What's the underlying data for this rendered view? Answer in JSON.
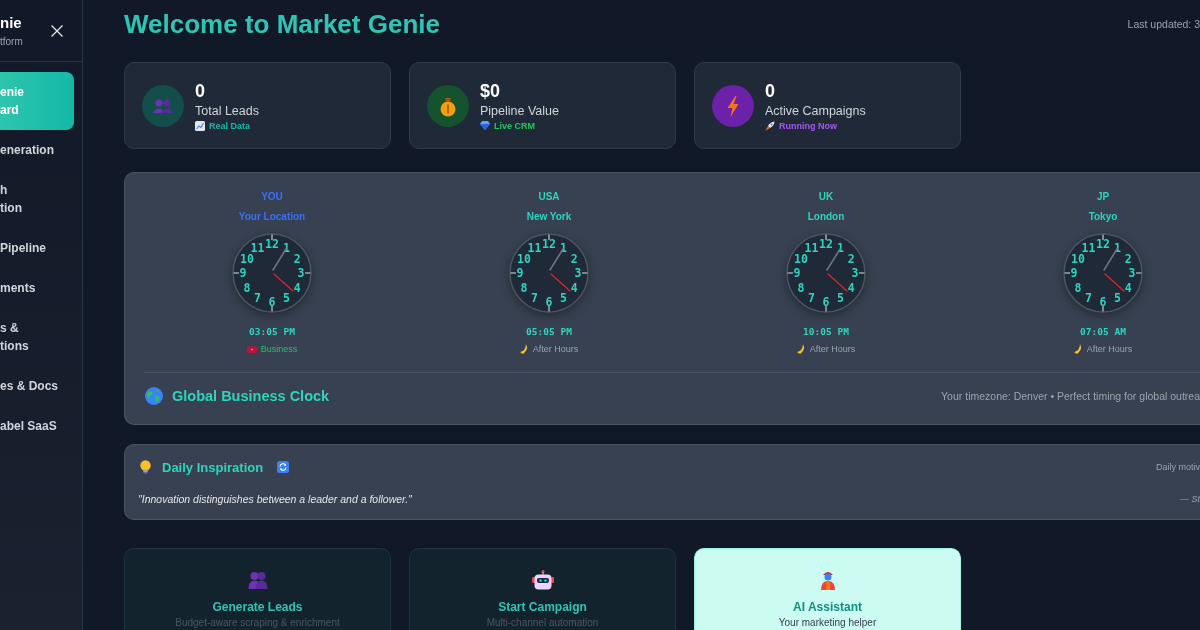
{
  "sidebar": {
    "brand": "nie",
    "tagline": "tform",
    "items": [
      {
        "lines": [
          "enie",
          "ard"
        ],
        "selected": true
      },
      {
        "lines": [
          "eneration"
        ],
        "selected": false
      },
      {
        "lines": [
          "h",
          "tion"
        ],
        "selected": false
      },
      {
        "lines": [
          "Pipeline"
        ],
        "selected": false
      },
      {
        "lines": [
          "ments"
        ],
        "selected": false
      },
      {
        "lines": [
          "s &",
          "tions"
        ],
        "selected": false
      },
      {
        "lines": [
          "es & Docs"
        ],
        "selected": false
      },
      {
        "lines": [
          "abel SaaS"
        ],
        "selected": false
      }
    ]
  },
  "header": {
    "title": "Welcome to Market Genie",
    "last_updated": "Last updated: 3"
  },
  "stats": [
    {
      "kind": "leads",
      "value": "0",
      "label": "Total Leads",
      "note": "Real Data"
    },
    {
      "kind": "pipeline",
      "value": "$0",
      "label": "Pipeline Value",
      "note": "Live CRM"
    },
    {
      "kind": "campaigns",
      "value": "0",
      "label": "Active Campaigns",
      "note": "Running Now"
    }
  ],
  "clock_panel": {
    "clocks": [
      {
        "code": "YOU",
        "city": "Your Location",
        "color": "#3b6ff6",
        "dial": [
          "11",
          "12",
          "1",
          "10",
          "2",
          "9",
          "3",
          "8",
          "4",
          "7",
          "5",
          "6"
        ],
        "time": "03:05 PM",
        "status": {
          "kind": "business",
          "label": "Business"
        }
      },
      {
        "code": "USA",
        "city": "New York",
        "color": "#2dd4bf",
        "dial": [
          "11",
          "12",
          "1",
          "10",
          "2",
          "9",
          "3",
          "8",
          "4",
          "7",
          "5",
          "6"
        ],
        "time": "05:05 PM",
        "status": {
          "kind": "after_hours",
          "label": "After Hours"
        }
      },
      {
        "code": "UK",
        "city": "London",
        "color": "#2dd4bf",
        "dial": [
          "11",
          "12",
          "1",
          "10",
          "2",
          "9",
          "3",
          "8",
          "4",
          "7",
          "5",
          "6"
        ],
        "time": "10:05 PM",
        "status": {
          "kind": "after_hours",
          "label": "After Hours"
        }
      },
      {
        "code": "JP",
        "city": "Tokyo",
        "color": "#2dd4bf",
        "dial": [
          "11",
          "12",
          "1",
          "10",
          "2",
          "9",
          "3",
          "8",
          "4",
          "7",
          "5",
          "6"
        ],
        "time": "07:05 AM",
        "status": {
          "kind": "after_hours",
          "label": "After Hours"
        }
      }
    ],
    "title": "Global Business Clock",
    "timezone_note": "Your timezone: Denver • Perfect timing for global outrea"
  },
  "inspiration": {
    "title": "Daily Inspiration",
    "side_note": "Daily motiv",
    "quote": "\"Innovation distinguishes between a leader and a follower.\"",
    "author": "— St"
  },
  "actions": [
    {
      "kind": "leads",
      "title": "Generate Leads",
      "subtitle": "Budget-aware scraping & enrichment",
      "highlighted": false
    },
    {
      "kind": "campaign",
      "title": "Start Campaign",
      "subtitle": "Multi-channel automation",
      "highlighted": false
    },
    {
      "kind": "assistant",
      "title": "AI Assistant",
      "subtitle": "Your marketing helper",
      "highlighted": true
    }
  ]
}
